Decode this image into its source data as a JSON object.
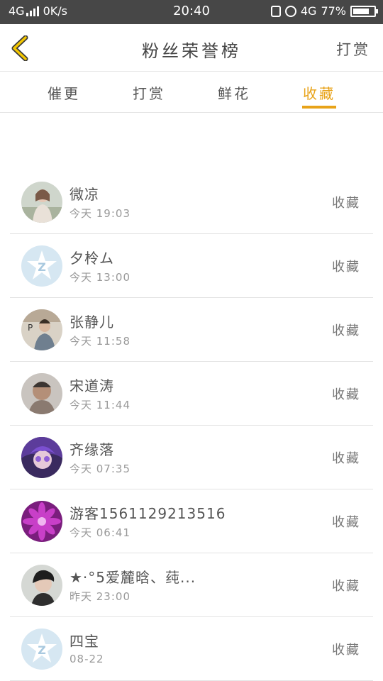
{
  "status_bar": {
    "network": "4G",
    "speed": "0K/s",
    "time": "20:40",
    "network_right": "4G",
    "battery": "77%",
    "battery_level": 0.77
  },
  "header": {
    "title": "粉丝荣誉榜",
    "right_action": "打赏",
    "back_icon": "chevron-left-icon",
    "accent_color": "#e8a319"
  },
  "tabs": [
    {
      "label": "催更",
      "active": false
    },
    {
      "label": "打赏",
      "active": false
    },
    {
      "label": "鲜花",
      "active": false
    },
    {
      "label": "收藏",
      "active": true
    }
  ],
  "fans": [
    {
      "name": "微凉",
      "time": "今天 19:03",
      "action": "收藏",
      "avatar": "photo-girl"
    },
    {
      "name": "夕柃ム",
      "time": "今天 13:00",
      "action": "收藏",
      "avatar": "default-qq-icon"
    },
    {
      "name": "张静儿",
      "time": "今天 11:58",
      "action": "收藏",
      "avatar": "photo-boy"
    },
    {
      "name": "宋道涛",
      "time": "今天 11:44",
      "action": "收藏",
      "avatar": "photo-man"
    },
    {
      "name": "齐缘落",
      "time": "今天 07:35",
      "action": "收藏",
      "avatar": "photo-anime"
    },
    {
      "name": "游客1561129213516",
      "time": "今天 06:41",
      "action": "收藏",
      "avatar": "photo-flower"
    },
    {
      "name": "★·°5爱麓晗、莼...",
      "time": "昨天 23:00",
      "action": "收藏",
      "avatar": "photo-boy-dark"
    },
    {
      "name": "四宝",
      "time": "08-22",
      "action": "收藏",
      "avatar": "default-qq-icon"
    }
  ]
}
